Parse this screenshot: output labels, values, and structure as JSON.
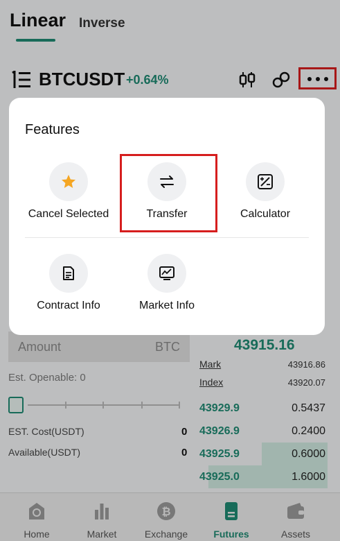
{
  "tabs": {
    "linear": "Linear",
    "inverse": "Inverse"
  },
  "header": {
    "symbol": "BTCUSDT",
    "change": "+0.64%"
  },
  "form": {
    "amount_label": "Amount",
    "amount_unit": "BTC",
    "est_openable": "Est. Openable: 0",
    "est_cost_label": "EST. Cost(USDT)",
    "est_cost_value": "0",
    "available_label": "Available(USDT)",
    "available_value": "0"
  },
  "orderbook": {
    "last_price": "43915.16",
    "mark_label": "Mark",
    "mark_value": "43916.86",
    "index_label": "Index",
    "index_value": "43920.07",
    "bids": [
      {
        "price": "43929.9",
        "qty": "0.5437",
        "depth": 0.0
      },
      {
        "price": "43926.9",
        "qty": "0.2400",
        "depth": 0.0
      },
      {
        "price": "43925.9",
        "qty": "0.6000",
        "depth": 0.5
      },
      {
        "price": "43925.0",
        "qty": "1.6000",
        "depth": 0.9
      }
    ]
  },
  "popup": {
    "title": "Features",
    "features": [
      {
        "label": "Cancel Selected",
        "icon": "star-icon"
      },
      {
        "label": "Transfer",
        "icon": "transfer-arrows-icon"
      },
      {
        "label": "Calculator",
        "icon": "calculator-icon"
      },
      {
        "label": "Contract Info",
        "icon": "document-icon"
      },
      {
        "label": "Market Info",
        "icon": "chart-monitor-icon"
      }
    ]
  },
  "nav": [
    {
      "label": "Home",
      "icon": "home-icon"
    },
    {
      "label": "Market",
      "icon": "bar-chart-icon"
    },
    {
      "label": "Exchange",
      "icon": "bitcoin-icon"
    },
    {
      "label": "Futures",
      "icon": "futures-icon",
      "active": true
    },
    {
      "label": "Assets",
      "icon": "wallet-icon"
    }
  ],
  "colors": {
    "accent": "#1f8a73",
    "highlight": "#d61e1e",
    "star": "#f5a623"
  }
}
